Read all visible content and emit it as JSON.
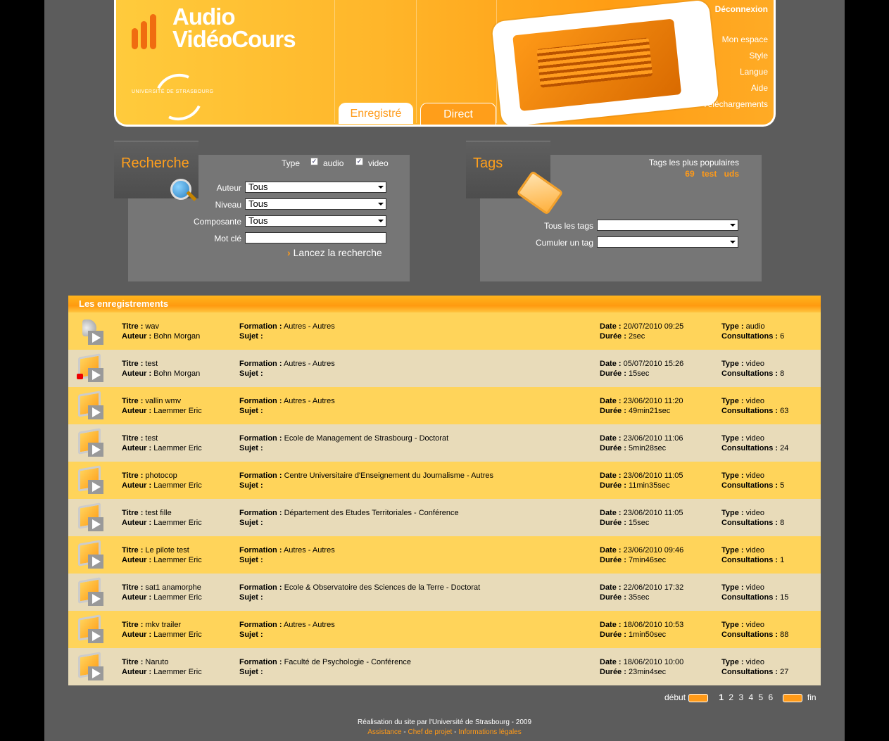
{
  "brand": {
    "line1": "Audio",
    "line2": "VidéoCours",
    "university": "UNIVERSITÉ DE STRASBOURG"
  },
  "nav": {
    "logout": "Déconnexion",
    "links": [
      "Mon espace",
      "Style",
      "Langue",
      "Aide",
      "Téléchargements"
    ]
  },
  "tabs": {
    "recorded": "Enregistré",
    "live": "Direct"
  },
  "search": {
    "title": "Recherche",
    "type_label": "Type",
    "audio_label": "audio",
    "video_label": "video",
    "author_label": "Auteur",
    "author_value": "Tous",
    "level_label": "Niveau",
    "level_value": "Tous",
    "component_label": "Composante",
    "component_value": "Tous",
    "keyword_label": "Mot clé",
    "keyword_value": "",
    "submit_label": "Lancez la recherche"
  },
  "tags": {
    "title": "Tags",
    "popular_label": "Tags les plus populaires",
    "popular": [
      "69",
      "test",
      "uds"
    ],
    "all_label": "Tous les tags",
    "all_value": "",
    "cumulate_label": "Cumuler un tag",
    "cumulate_value": ""
  },
  "recordings": {
    "header": "Les enregistrements",
    "labels": {
      "title": "Titre :",
      "author": "Auteur :",
      "formation": "Formation :",
      "subject": "Sujet :",
      "date": "Date :",
      "duration": "Durée :",
      "type": "Type :",
      "views": "Consultations :"
    },
    "rows": [
      {
        "title": "wav",
        "author": "Bohn Morgan",
        "formation": "Autres - Autres",
        "subject": "",
        "date": "20/07/2010 09:25",
        "duration": "2sec",
        "type": "audio",
        "views": "6",
        "icon": "speaker-icon"
      },
      {
        "title": "test",
        "author": "Bohn Morgan",
        "formation": "Autres - Autres",
        "subject": "",
        "date": "05/07/2010 15:26",
        "duration": "15sec",
        "type": "video",
        "views": "8",
        "icon": "video-locked-icon"
      },
      {
        "title": "vallin wmv",
        "author": "Laemmer Eric",
        "formation": "Autres - Autres",
        "subject": "",
        "date": "23/06/2010 11:20",
        "duration": "49min21sec",
        "type": "video",
        "views": "63",
        "icon": "video-icon"
      },
      {
        "title": "test",
        "author": "Laemmer Eric",
        "formation": "Ecole de Management de Strasbourg - Doctorat",
        "subject": "",
        "date": "23/06/2010 11:06",
        "duration": "5min28sec",
        "type": "video",
        "views": "24",
        "icon": "video-icon"
      },
      {
        "title": "photocop",
        "author": "Laemmer Eric",
        "formation": "Centre Universitaire d'Enseignement du Journalisme - Autres",
        "subject": "",
        "date": "23/06/2010 11:05",
        "duration": "11min35sec",
        "type": "video",
        "views": "5",
        "icon": "video-icon"
      },
      {
        "title": "test fille",
        "author": "Laemmer Eric",
        "formation": "Département des Etudes Territoriales - Conférence",
        "subject": "",
        "date": "23/06/2010 11:05",
        "duration": "15sec",
        "type": "video",
        "views": "8",
        "icon": "video-icon"
      },
      {
        "title": "Le pilote test",
        "author": "Laemmer Eric",
        "formation": "Autres - Autres",
        "subject": "",
        "date": "23/06/2010 09:46",
        "duration": "7min46sec",
        "type": "video",
        "views": "1",
        "icon": "video-icon"
      },
      {
        "title": "sat1 anamorphe",
        "author": "Laemmer Eric",
        "formation": "Ecole & Observatoire des Sciences de la Terre - Doctorat",
        "subject": "",
        "date": "22/06/2010 17:32",
        "duration": "35sec",
        "type": "video",
        "views": "15",
        "icon": "video-icon"
      },
      {
        "title": "mkv trailer",
        "author": "Laemmer Eric",
        "formation": "Autres - Autres",
        "subject": "",
        "date": "18/06/2010 10:53",
        "duration": "1min50sec",
        "type": "video",
        "views": "88",
        "icon": "video-icon"
      },
      {
        "title": "Naruto",
        "author": "Laemmer Eric",
        "formation": "Faculté de Psychologie - Conférence",
        "subject": "",
        "date": "18/06/2010 10:00",
        "duration": "23min4sec",
        "type": "video",
        "views": "27",
        "icon": "video-icon"
      }
    ]
  },
  "pagination": {
    "first": "début",
    "last": "fin",
    "pages": [
      "1",
      "2",
      "3",
      "4",
      "5",
      "6"
    ],
    "current": "1"
  },
  "footer": {
    "credit": "Réalisation du site par l'Université de Strasbourg - 2009",
    "links": [
      "Assistance",
      "Chef de projet",
      "Informations légales"
    ],
    "separator": "-"
  },
  "colors": {
    "accent": "#ff9a18",
    "row_odd": "#ffd45a",
    "row_even": "#e8dbb9",
    "page_bg": "#5c5c5c"
  }
}
